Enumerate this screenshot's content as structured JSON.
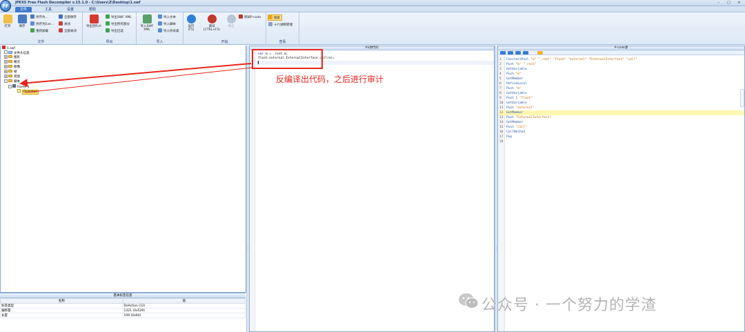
{
  "window": {
    "title": "JPEXS Free Flash Decompiler v.15.1.0 - C:\\Users\\Z\\Desktop\\1.swf",
    "logo_text": "FFDec",
    "controls": [
      "–",
      "□",
      "✕"
    ]
  },
  "menu": {
    "tabs": [
      "文件",
      "工具",
      "设置",
      "帮助"
    ]
  },
  "ribbon": {
    "file": {
      "label": "文件",
      "open": "打开",
      "save": "保存",
      "save_as": "另存为...",
      "save_as_exe": "另存为Exe...",
      "reload": "重新加载",
      "save_all": "全部保存",
      "close": "关闭",
      "close_all": "全部关闭"
    },
    "export": {
      "label": "导出",
      "export_fla": "导出到FLA",
      "export_swf_xml": "导出SWF XML",
      "export_all": "导出所有部分",
      "export_selected": "导出已选"
    },
    "import": {
      "label": "导入",
      "import_swf_xml": "导入SWF XML",
      "import_text": "导入文本",
      "import_script": "导入脚本",
      "import_symbol_class": "导入符号类"
    },
    "debug": {
      "label": "开始",
      "run": "运行",
      "run_key": "(F5)",
      "debug": "调试",
      "debug_key": "(CTRL+F5)",
      "stop": "停止",
      "debug_pcode": "调试P-code"
    },
    "view": {
      "label": "查看",
      "search": "搜索",
      "hex_dump": "十六进制转储"
    }
  },
  "tree": {
    "root": "1.swf",
    "items": [
      "文件头信息",
      "图形",
      "精灵",
      "图像",
      "帧",
      "其他",
      "脚本"
    ],
    "frame": "frame 1",
    "selected": "DoAction"
  },
  "info_panel": {
    "title": "基本标签信息",
    "columns": [
      "名称",
      "值"
    ],
    "rows": [
      [
        "标签类型",
        "DoAction (12)"
      ],
      [
        "偏移量",
        "1321 (0x529)"
      ],
      [
        "长度",
        "109 (0x6d)"
      ]
    ]
  },
  "as_panel": {
    "title": "AS源代码",
    "code": [
      {
        "kw": "var",
        "rest": " m = _root.m;"
      },
      {
        "kw": "",
        "rest": "flash.external.ExternalInterface.call(m);"
      },
      {
        "kw": "",
        "rest": ""
      }
    ]
  },
  "pcode_panel": {
    "title": "P-code源",
    "lines": [
      "ConstantPool \"m\" \"_root\" \"flash\" \"external\" \"ExternalInterface\" \"call\"",
      "Push \"m\" \"_root\"",
      "GetVariable",
      "Push \"m\"",
      "GetMember",
      "DefineLocal",
      "Push \"m\"",
      "GetVariable",
      "Push 1 \"flash\"",
      "GetVariable",
      "Push \"external\"",
      "GetMember",
      "Push \"ExternalInterface\"",
      "GetMember",
      "Push \"call\"",
      "CallMethod",
      "Pop",
      ""
    ],
    "highlight_line": 12
  },
  "annotation": {
    "text": "反编译出代码，之后进行审计"
  },
  "watermark": {
    "text": "公众号 · 一个努力的学渣"
  },
  "colors": {
    "annotation_red": "#e8261b",
    "ribbon_blue": "#3c7ad0"
  }
}
